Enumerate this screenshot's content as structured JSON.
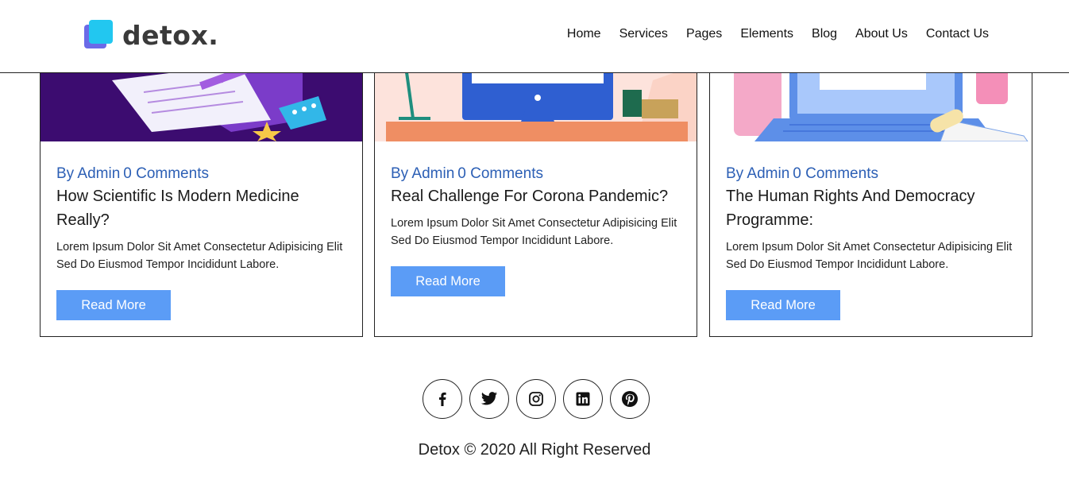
{
  "brand": {
    "name": "detox."
  },
  "nav": [
    "Home",
    "Services",
    "Pages",
    "Elements",
    "Blog",
    "About Us",
    "Contact Us"
  ],
  "posts": [
    {
      "author": "By Admin",
      "comments": "0 Comments",
      "title": "How Scientific Is Modern Medicine Really?",
      "excerpt": "Lorem Ipsum Dolor Sit Amet Consectetur Adipisicing Elit Sed Do Eiusmod Tempor Incididunt Labore.",
      "cta": "Read More"
    },
    {
      "author": "By Admin",
      "comments": "0 Comments",
      "title": "Real Challenge For Corona Pandemic?",
      "excerpt": "Lorem Ipsum Dolor Sit Amet Consectetur Adipisicing Elit Sed Do Eiusmod Tempor Incididunt Labore.",
      "cta": "Read More"
    },
    {
      "author": "By Admin",
      "comments": "0 Comments",
      "title": "The Human Rights And Democracy Programme:",
      "excerpt": "Lorem Ipsum Dolor Sit Amet Consectetur Adipisicing Elit Sed Do Eiusmod Tempor Incididunt Labore.",
      "cta": "Read More"
    }
  ],
  "social": [
    "facebook-icon",
    "twitter-icon",
    "instagram-icon",
    "linkedin-icon",
    "pinterest-icon"
  ],
  "footer": {
    "copyright": "Detox © 2020 All Right Reserved"
  },
  "colors": {
    "accent_blue": "#5b9cf6",
    "meta_blue": "#2c5fb5",
    "logo_cyan": "#22c7f0",
    "logo_purple": "#6b6ae8"
  }
}
